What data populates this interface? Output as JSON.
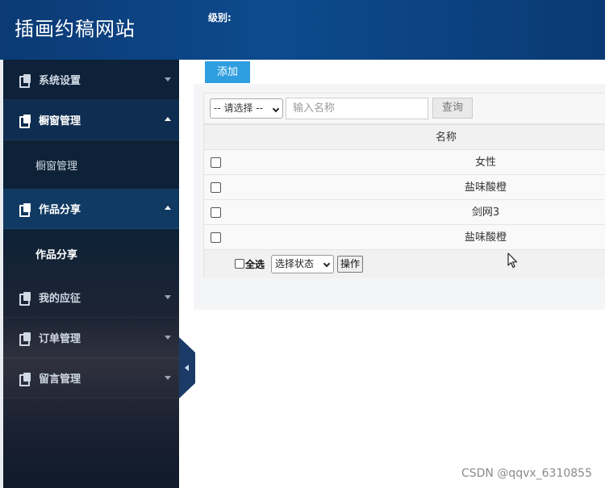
{
  "header": {
    "site_title": "插画约稿网站",
    "level_label": "级别:"
  },
  "sidebar": {
    "items": [
      {
        "label": "系统设置",
        "state": "collapsed"
      },
      {
        "label": "橱窗管理",
        "state": "expanded",
        "sub": [
          "橱窗管理"
        ]
      },
      {
        "label": "作品分享",
        "state": "expanded",
        "sub": [
          "作品分享"
        ]
      },
      {
        "label": "我的应征",
        "state": "collapsed"
      },
      {
        "label": "订单管理",
        "state": "collapsed"
      },
      {
        "label": "留言管理",
        "state": "collapsed"
      }
    ]
  },
  "toolbar": {
    "add_label": "添加"
  },
  "search": {
    "select_value": "-- 请选择 --",
    "placeholder": "输入名称",
    "query_label": "查询"
  },
  "table": {
    "columns": [
      "名称"
    ],
    "rows": [
      "女性",
      "盐味酸橙",
      "剑网3",
      "盐味酸橙"
    ]
  },
  "footer": {
    "select_all_label": "全选",
    "state_select_value": "选择状态",
    "action_label": "操作"
  },
  "watermark": "CSDN @qqvx_6310855",
  "colors": {
    "header_bg": "#0d4a8e",
    "sidebar_bg": "#0d2138",
    "accent_button": "#2e9ee0"
  }
}
